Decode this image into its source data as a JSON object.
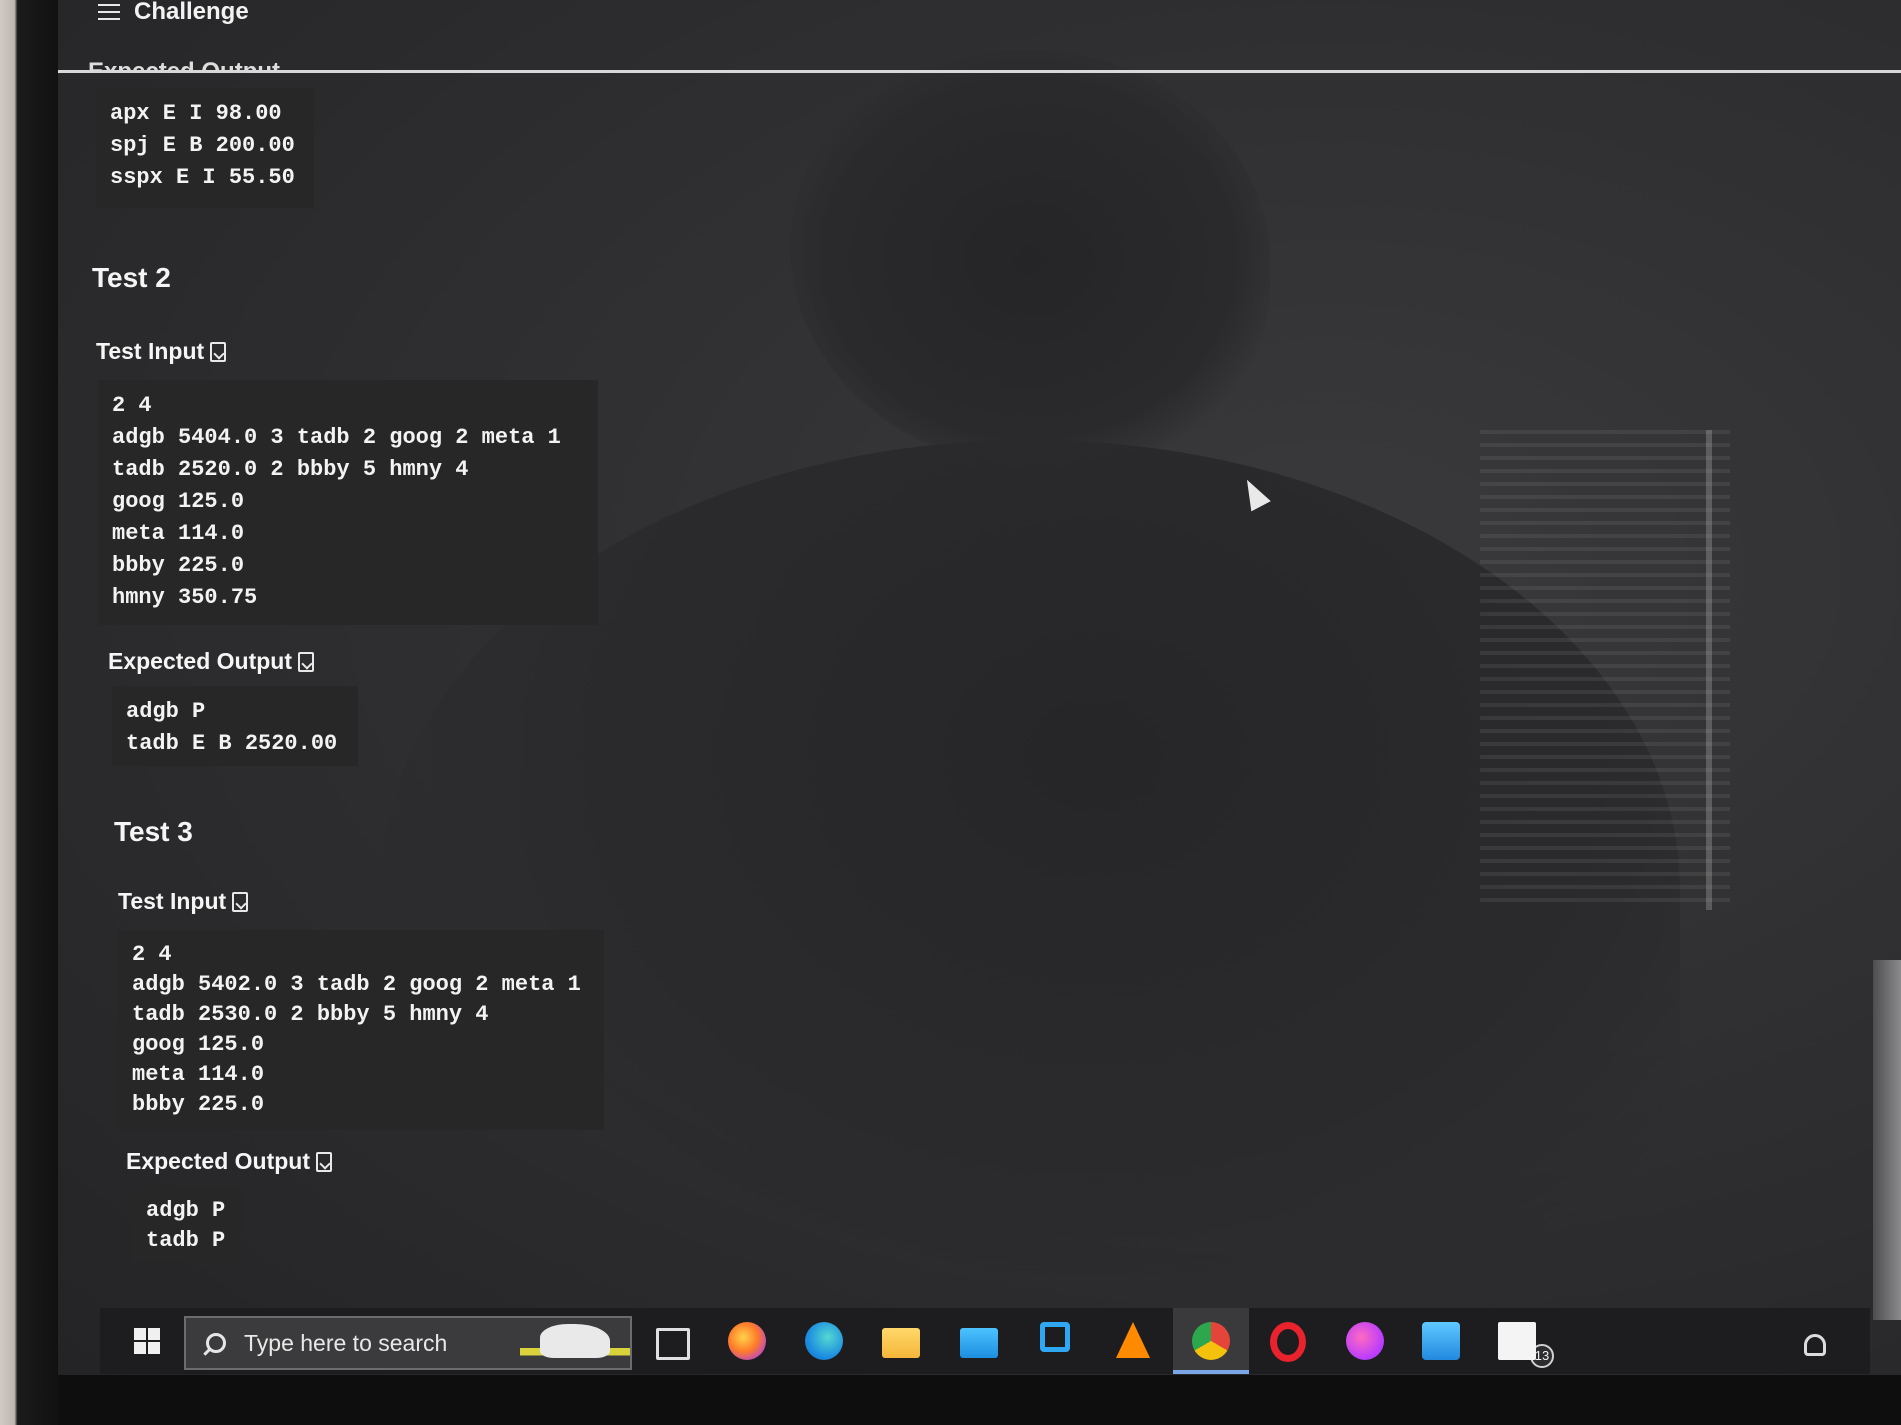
{
  "app": {
    "title": "Challenge",
    "cut_heading": "Expected Output"
  },
  "top_output": {
    "lines": [
      "apx E I 98.00",
      "spj E B 200.00",
      "sspx E I 55.50"
    ]
  },
  "test2": {
    "title": "Test 2",
    "input_label": "Test Input",
    "input_lines": [
      "2 4",
      "adgb 5404.0 3 tadb 2 goog 2 meta 1",
      "tadb 2520.0 2 bbby 5 hmny 4",
      "goog 125.0",
      "meta 114.0",
      "bbby 225.0",
      "hmny 350.75"
    ],
    "output_label": "Expected Output",
    "output_lines": [
      "adgb P",
      "tadb E B 2520.00"
    ]
  },
  "test3": {
    "title": "Test 3",
    "input_label": "Test Input",
    "input_lines": [
      "2 4",
      "adgb 5402.0 3 tadb 2 goog 2 meta 1",
      "tadb 2530.0 2 bbby 5 hmny 4",
      "goog 125.0",
      "meta 114.0",
      "bbby 225.0"
    ],
    "output_label": "Expected Output",
    "output_lines": [
      "adgb P",
      "tadb P"
    ]
  },
  "taskbar": {
    "search_placeholder": "Type here to search",
    "badge_count": "13",
    "icons": [
      "start-icon",
      "task-view-icon",
      "firefox-icon",
      "edge-icon",
      "file-explorer-icon",
      "mail-icon",
      "vscode-icon",
      "vlc-icon",
      "chrome-icon",
      "opera-icon",
      "messenger-icon",
      "chat-icon",
      "app-icon",
      "people-icon"
    ]
  },
  "colors": {
    "code_bg": "#272728",
    "text": "#f3f3f3",
    "active_tab_underline": "#79a7e8"
  }
}
